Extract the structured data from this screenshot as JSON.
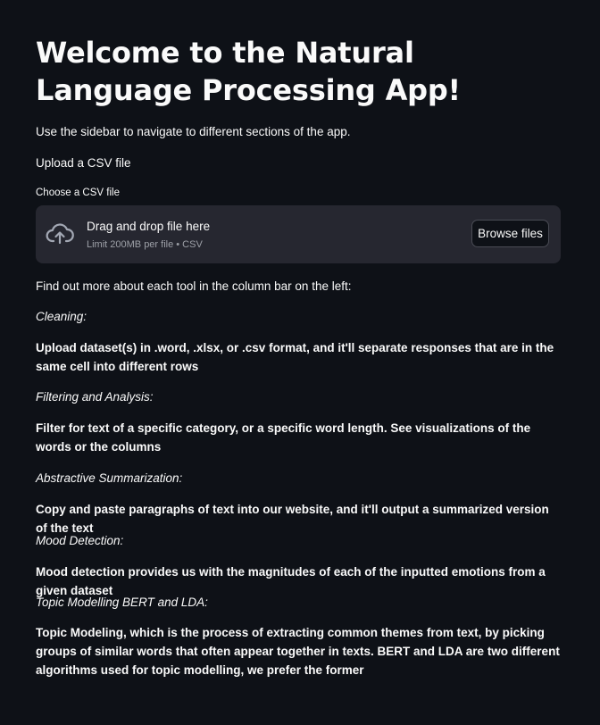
{
  "page": {
    "title": "Welcome to the Natural Language Processing App!",
    "intro": "Use the sidebar to navigate to different sections of the app.",
    "upload_heading": "Upload a CSV file"
  },
  "uploader": {
    "label": "Choose a CSV file",
    "drop_title": "Drag and drop file here",
    "limit_text": "Limit 200MB per file • CSV",
    "browse_label": "Browse files",
    "icon": "cloud-upload-icon"
  },
  "info": {
    "lead": "Find out more about each tool in the column bar on the left:",
    "sections": [
      {
        "heading": "Cleaning:",
        "description": "Upload dataset(s) in .word, .xlsx, or .csv format, and it'll separate responses that are in the same cell into different rows"
      },
      {
        "heading": "Filtering and Analysis:",
        "description": "Filter for text of a specific category, or a specific word length. See visualizations of the words or the columns"
      },
      {
        "heading": "Abstractive Summarization:",
        "description": "Copy and paste paragraphs of text into our website, and it'll output a summarized version of the text"
      },
      {
        "heading": "Mood Detection:",
        "description": "Mood detection provides us with the magnitudes of each of the inputted emotions from a given dataset"
      },
      {
        "heading": "Topic Modelling BERT and LDA:",
        "description": "Topic Modeling, which is the process of extracting common themes from text, by picking groups of similar words that often appear together in texts. BERT and LDA are two different algorithms used for topic modelling, we prefer the former"
      }
    ]
  },
  "colors": {
    "background": "#0e1117",
    "text": "#fafafa",
    "uploader_bg": "#262730",
    "muted": "#9da0a7"
  }
}
